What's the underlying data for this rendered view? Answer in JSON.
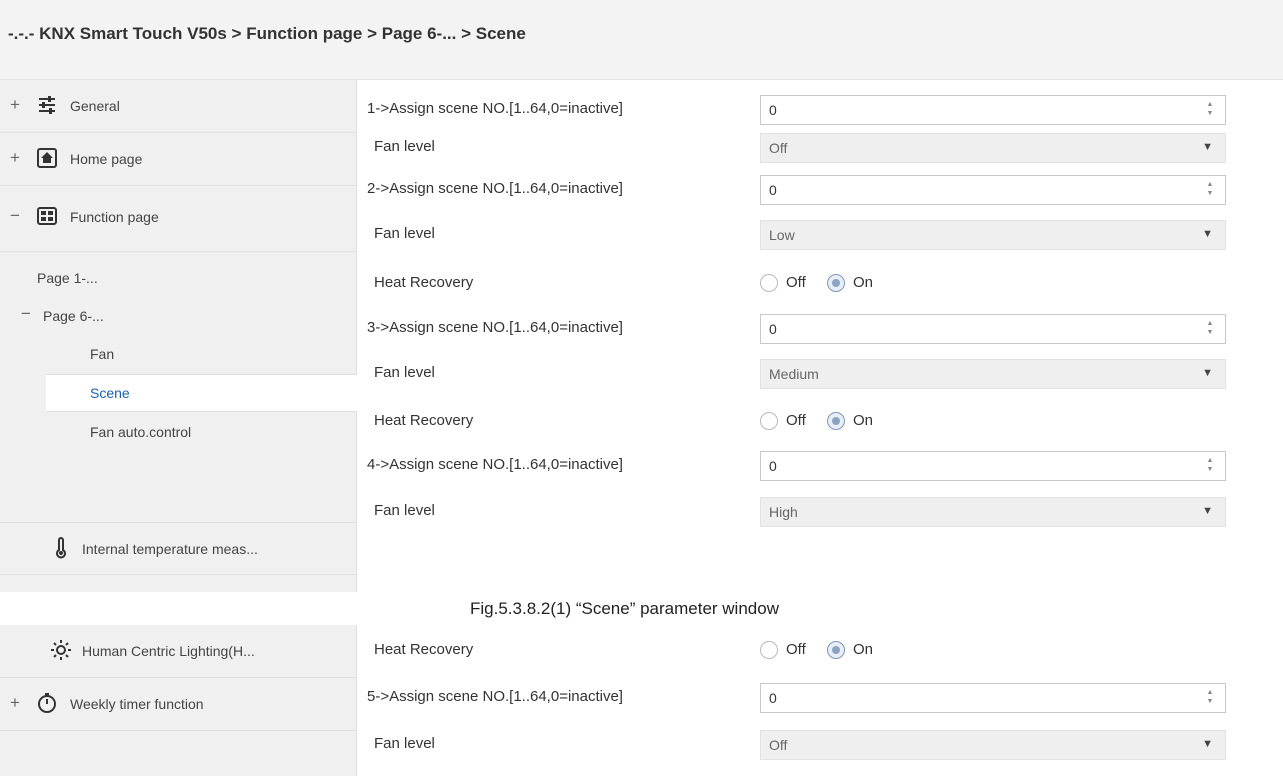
{
  "breadcrumb": "-.-.- KNX Smart Touch V50s > Function page > Page 6-... > Scene",
  "sidebar": {
    "general": {
      "toggle": "+",
      "label": "General",
      "icon": "sliders-icon"
    },
    "home_page": {
      "toggle": "+",
      "label": "Home page",
      "icon": "home-icon"
    },
    "function_page": {
      "toggle": "−",
      "label": "Function page",
      "icon": "grid-icon"
    },
    "page1": "Page 1-...",
    "page6": {
      "toggle": "−",
      "label": "Page 6-..."
    },
    "fan": "Fan",
    "scene": "Scene",
    "fan_auto": "Fan auto.control",
    "internal_temp": {
      "label": "Internal temperature meas...",
      "icon": "thermometer-icon"
    },
    "hcl": {
      "label": "Human Centric Lighting(H...",
      "icon": "sun-icon"
    },
    "weekly_timer": {
      "toggle": "+",
      "label": "Weekly timer function",
      "icon": "timer-icon"
    }
  },
  "params": {
    "scene1_label": "1->Assign scene NO.[1..64,0=inactive]",
    "scene1_value": "0",
    "fan1_label": "Fan level",
    "fan1_value": "Off",
    "scene2_label": "2->Assign scene NO.[1..64,0=inactive]",
    "scene2_value": "0",
    "fan2_label": "Fan level",
    "fan2_value": "Low",
    "heat2_label": "Heat Recovery",
    "scene3_label": "3->Assign scene NO.[1..64,0=inactive]",
    "scene3_value": "0",
    "fan3_label": "Fan level",
    "fan3_value": "Medium",
    "heat3_label": "Heat Recovery",
    "scene4_label": "4->Assign scene NO.[1..64,0=inactive]",
    "scene4_value": "0",
    "fan4_label": "Fan level",
    "fan4_value": "High",
    "heat4_label": "Heat Recovery",
    "scene5_label": "5->Assign scene NO.[1..64,0=inactive]",
    "scene5_value": "0",
    "fan5_label": "Fan level",
    "fan5_value": "Off",
    "radio_off": "Off",
    "radio_on": "On"
  },
  "caption": "Fig.5.3.8.2(1) “Scene” parameter window"
}
